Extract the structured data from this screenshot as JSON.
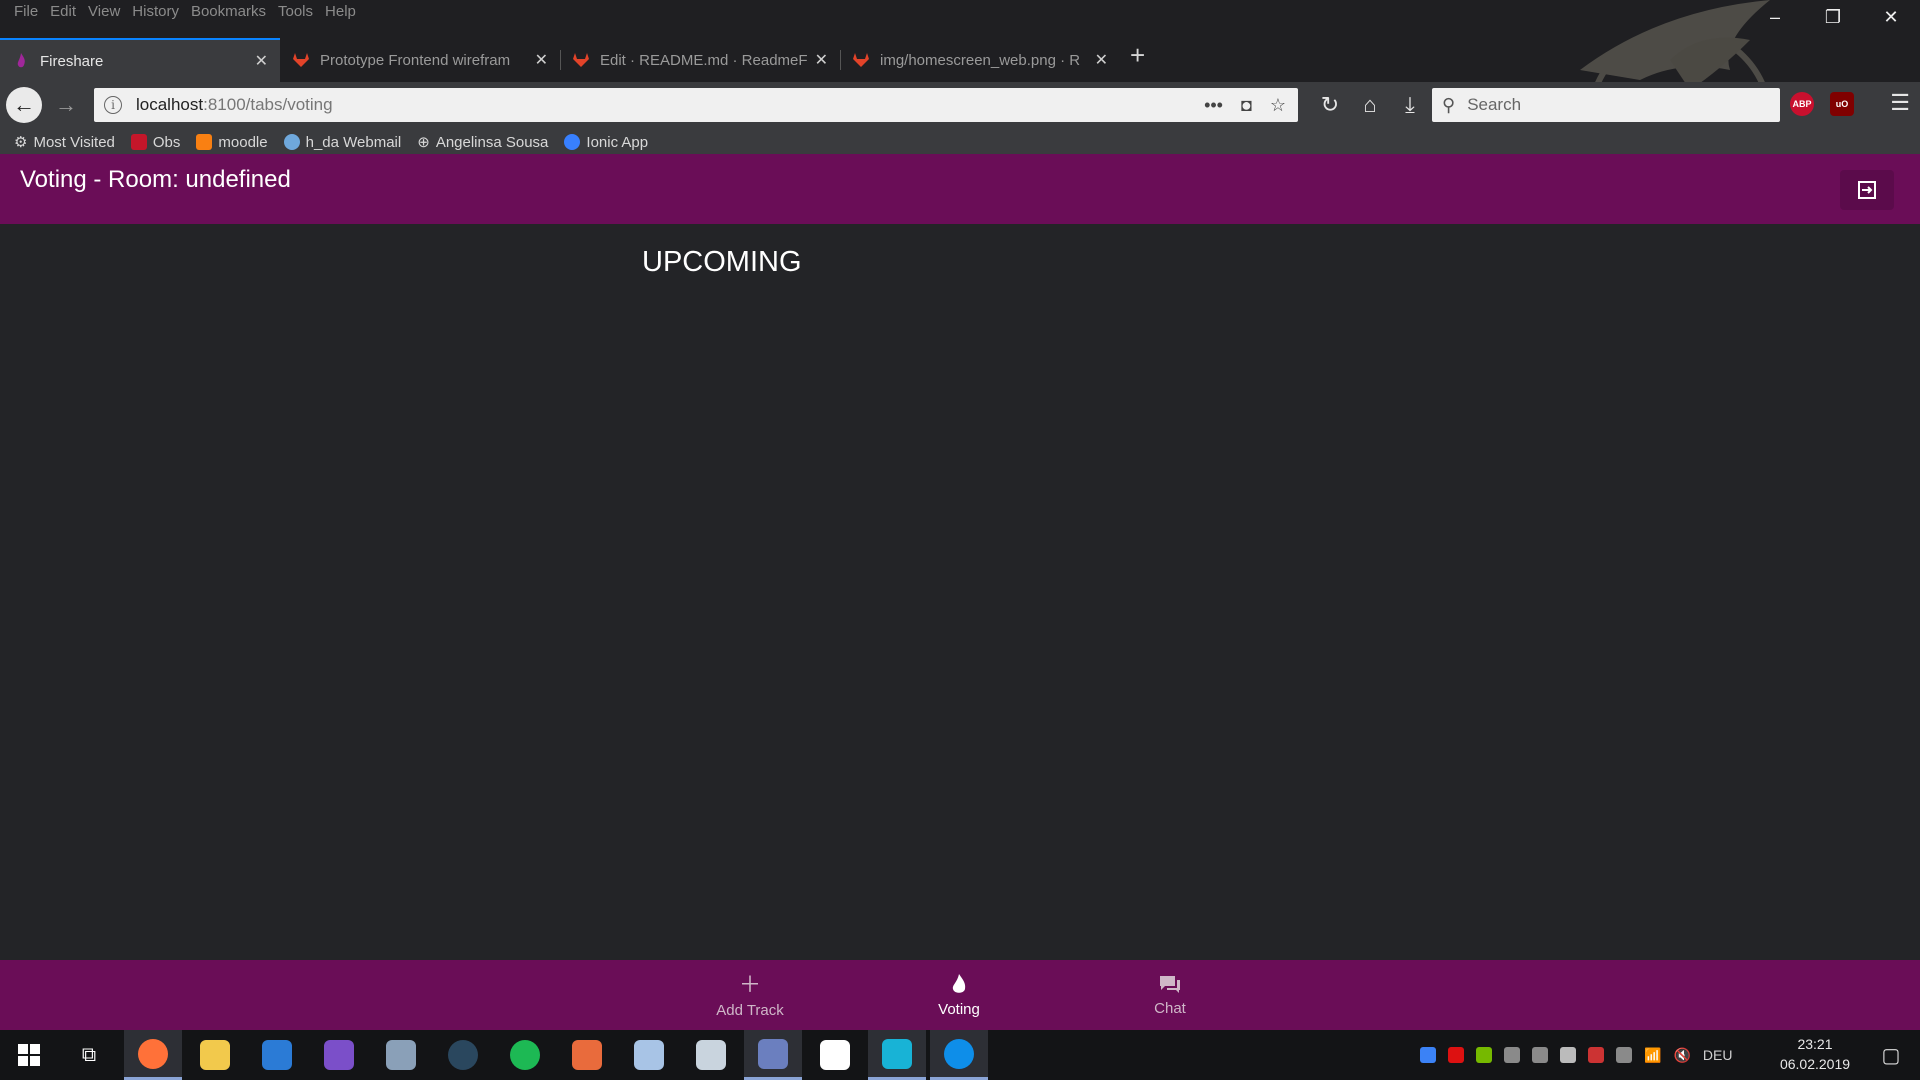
{
  "browser": {
    "menu": [
      "File",
      "Edit",
      "View",
      "History",
      "Bookmarks",
      "Tools",
      "Help"
    ],
    "tabs": [
      {
        "label": "Fireshare",
        "active": true
      },
      {
        "label": "Prototype Frontend wirefram",
        "active": false
      },
      {
        "label": "Edit · README.md · ReadmeF",
        "active": false
      },
      {
        "label": "img/homescreen_web.png · R",
        "active": false
      }
    ],
    "new_tab": "+",
    "window_controls": {
      "minimize": "–",
      "restore": "❐",
      "close": "✕"
    },
    "url": {
      "host": "localhost",
      "rest": ":8100/tabs/voting"
    },
    "search_placeholder": "Search",
    "bookmarks": [
      "Most Visited",
      "Obs",
      "moodle",
      "h_da Webmail",
      "Angelinsa Sousa",
      "Ionic App"
    ],
    "extensions": [
      "ABP",
      "uO"
    ]
  },
  "app": {
    "title": "Voting - Room: undefined",
    "section_heading": "UPCOMING",
    "tabs": [
      {
        "label": "Add Track",
        "icon": "plus-icon",
        "selected": false
      },
      {
        "label": "Voting",
        "icon": "flame-icon",
        "selected": true
      },
      {
        "label": "Chat",
        "icon": "chat-icon",
        "selected": false
      }
    ],
    "accent_color": "#6a0d57"
  },
  "taskbar": {
    "language": "DEU",
    "time": "23:21",
    "date": "06.02.2019"
  }
}
